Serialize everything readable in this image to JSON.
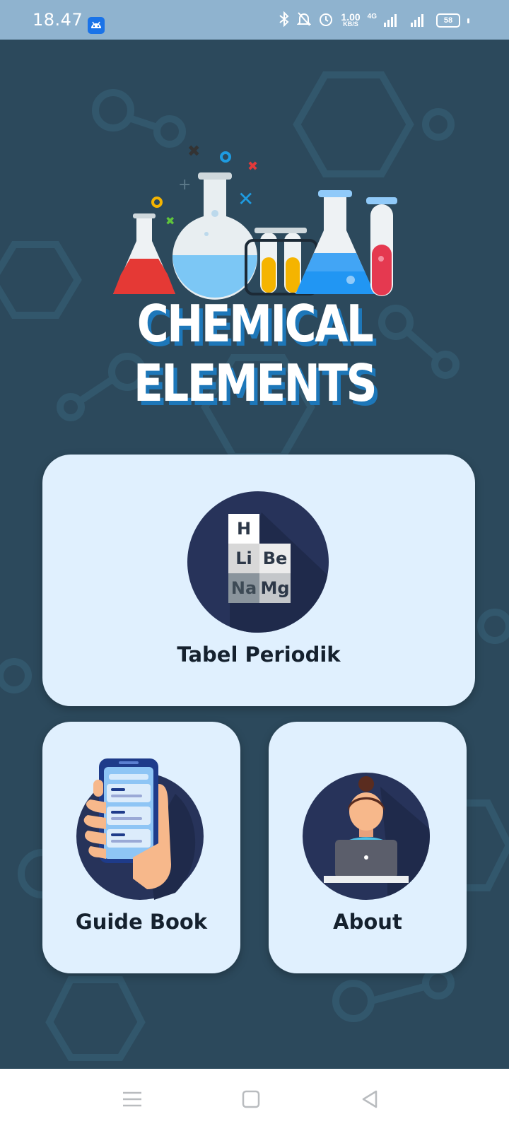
{
  "status_bar": {
    "time": "18.47",
    "net_speed_value": "1.00",
    "net_speed_unit": "KB/S",
    "network_type": "4G",
    "battery": "58"
  },
  "hero": {
    "title": "CHEMICAL ELEMENTS"
  },
  "menu": {
    "periodic_table": {
      "label": "Tabel Periodik",
      "elements": [
        "H",
        "Li",
        "Be",
        "Na",
        "Mg"
      ]
    },
    "guide_book": {
      "label": "Guide Book"
    },
    "about": {
      "label": "About"
    }
  },
  "colors": {
    "status_bar_bg": "#8fb3cf",
    "app_bg": "#2c495c",
    "card_bg": "#e0f0fe",
    "icon_circle": "#27335a",
    "title_shadow": "#1d77b9"
  },
  "icons": {
    "status_left": "android-notification-icon",
    "status_right": [
      "bluetooth-icon",
      "mute-icon",
      "alarm-icon",
      "signal-icon",
      "signal-icon",
      "battery-icon"
    ],
    "nav": [
      "menu-icon",
      "home-icon",
      "back-icon"
    ]
  }
}
